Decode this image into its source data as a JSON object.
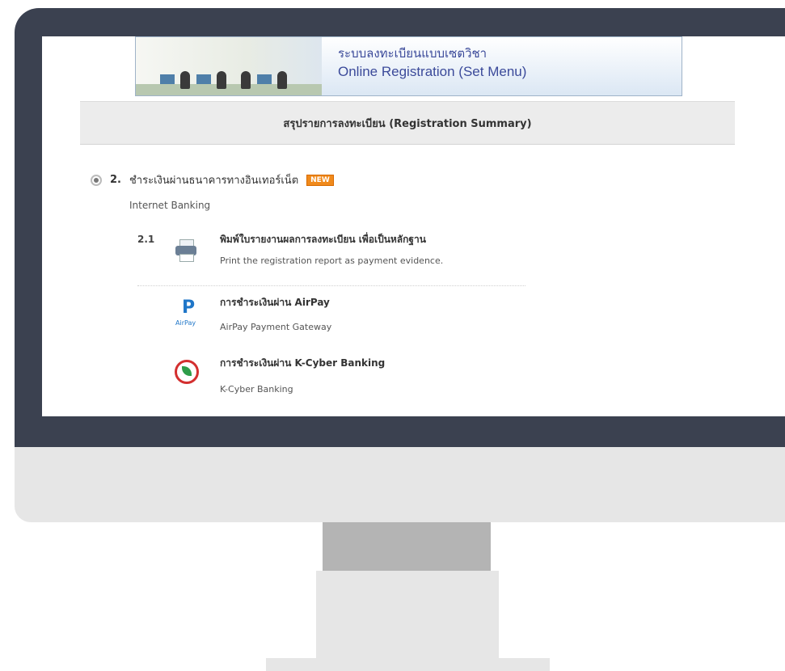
{
  "banner": {
    "title_th": "ระบบลงทะเบียนแบบเซตวิชา",
    "title_en": "Online Registration (Set Menu)"
  },
  "summary_header": "สรุปรายการลงทะเบียน (Registration Summary)",
  "step": {
    "number": "2.",
    "title": "ชำระเงินผ่านธนาคารทางอินเทอร์เน็ต",
    "badge": "NEW",
    "subtitle": "Internet Banking"
  },
  "substep": {
    "number": "2.1",
    "title": "พิมพ์ใบรายงานผลการลงทะเบียน เพื่อเป็นหลักฐาน",
    "description": "Print the registration report as payment evidence."
  },
  "options": [
    {
      "title": "การชำระเงินผ่าน AirPay",
      "description": "AirPay Payment Gateway",
      "icon": "airpay-icon",
      "icon_caption": "AirPay"
    },
    {
      "title": "การชำระเงินผ่าน K-Cyber Banking",
      "description": "K-Cyber Banking",
      "icon": "kbank-icon"
    }
  ],
  "colors": {
    "monitor_frame": "#3b4150",
    "badge": "#f08a1c",
    "banner_text": "#3b4a9a"
  }
}
